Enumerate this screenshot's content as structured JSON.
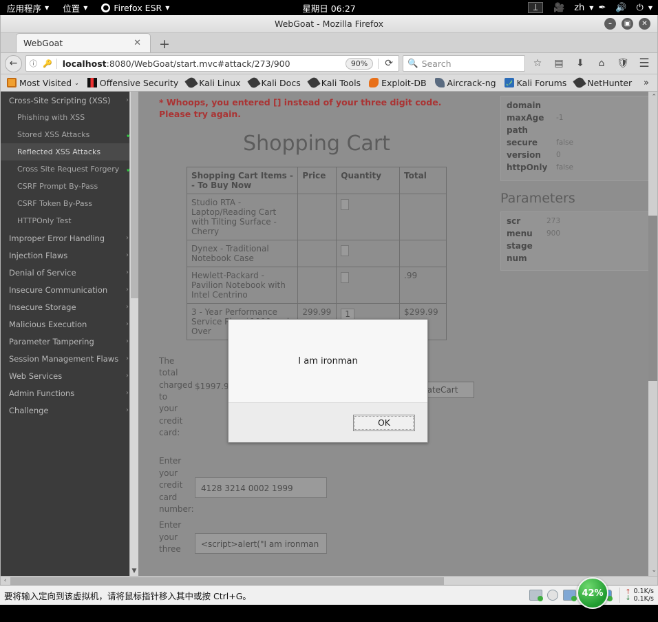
{
  "desktop": {
    "menus": [
      {
        "label": "应用程序",
        "icon": "apps-menu-icon"
      },
      {
        "label": "位置",
        "icon": "places-menu-icon"
      },
      {
        "label": "Firefox ESR",
        "icon": "firefox-icon"
      }
    ],
    "clock": "星期日 06:27",
    "workspace": "1",
    "tray": [
      {
        "name": "camera-icon",
        "glyph": "🎥"
      },
      {
        "name": "input-method-label",
        "glyph": "zh"
      },
      {
        "name": "pen-icon",
        "glyph": "✒"
      },
      {
        "name": "volume-icon",
        "glyph": "🔊"
      },
      {
        "name": "power-icon",
        "glyph": "⏻"
      }
    ]
  },
  "window": {
    "title": "WebGoat - Mozilla Firefox",
    "minimize": "–",
    "maximize": "▣",
    "close": "✕"
  },
  "tabs": {
    "items": [
      {
        "title": "WebGoat",
        "close": "✕"
      }
    ],
    "new_tab": "+"
  },
  "nav": {
    "back": "←",
    "info_icon": "ⓘ",
    "key_icon": "🔑",
    "url_host": "localhost",
    "url_rest": ":8080/WebGoat/start.mvc#attack/273/900",
    "zoom": "90%",
    "reload": "⟳",
    "search_placeholder": "Search",
    "search_icon": "🔍",
    "toolbar_icons": [
      {
        "name": "bookmark-star-icon",
        "glyph": "☆"
      },
      {
        "name": "library-icon",
        "glyph": "▤"
      },
      {
        "name": "downloads-icon",
        "glyph": "⬇"
      },
      {
        "name": "home-icon",
        "glyph": "⌂"
      },
      {
        "name": "shield-icon",
        "glyph": "🛡"
      },
      {
        "name": "hamburger-menu-icon",
        "glyph": "☰"
      }
    ]
  },
  "bookmarks": {
    "items": [
      {
        "label": "Most Visited",
        "icon": "ico-mv",
        "caret": "⌄"
      },
      {
        "label": "Offensive Security",
        "icon": "ico-os"
      },
      {
        "label": "Kali Linux",
        "icon": "ico-dragon"
      },
      {
        "label": "Kali Docs",
        "icon": "ico-dragon"
      },
      {
        "label": "Kali Tools",
        "icon": "ico-dragon"
      },
      {
        "label": "Exploit-DB",
        "icon": "ico-exp"
      },
      {
        "label": "Aircrack-ng",
        "icon": "ico-air"
      },
      {
        "label": "Kali Forums",
        "icon": "ico-kf"
      },
      {
        "label": "NetHunter",
        "icon": "ico-dragon"
      }
    ],
    "overflow": "»"
  },
  "sidebar": {
    "items": [
      {
        "label": "Cross-Site Scripting (XSS)",
        "type": "group",
        "chevron": "›"
      },
      {
        "label": "Phishing with XSS",
        "type": "sub"
      },
      {
        "label": "Stored XSS Attacks",
        "type": "sub",
        "check": "✅"
      },
      {
        "label": "Reflected XSS Attacks",
        "type": "sub",
        "active": true
      },
      {
        "label": "Cross Site Request Forgery (CSRF)",
        "type": "sub",
        "check": "✅"
      },
      {
        "label": "CSRF Prompt By-Pass",
        "type": "sub"
      },
      {
        "label": "CSRF Token By-Pass",
        "type": "sub"
      },
      {
        "label": "HTTPOnly Test",
        "type": "sub"
      },
      {
        "label": "Improper Error Handling",
        "type": "group",
        "chevron": "›"
      },
      {
        "label": "Injection Flaws",
        "type": "group",
        "chevron": "›"
      },
      {
        "label": "Denial of Service",
        "type": "group",
        "chevron": "›"
      },
      {
        "label": "Insecure Communication",
        "type": "group",
        "chevron": "›"
      },
      {
        "label": "Insecure Storage",
        "type": "group",
        "chevron": "›"
      },
      {
        "label": "Malicious Execution",
        "type": "group",
        "chevron": "›"
      },
      {
        "label": "Parameter Tampering",
        "type": "group",
        "chevron": "›"
      },
      {
        "label": "Session Management Flaws",
        "type": "group",
        "chevron": "›"
      },
      {
        "label": "Web Services",
        "type": "group",
        "chevron": "›"
      },
      {
        "label": "Admin Functions",
        "type": "group",
        "chevron": "›"
      },
      {
        "label": "Challenge",
        "type": "group",
        "chevron": "›"
      }
    ],
    "scroll_up": "▲",
    "scroll_down": "▼"
  },
  "main": {
    "error_message": "* Whoops, you entered [] instead of your three digit code. Please try again.",
    "title": "Shopping Cart",
    "table": {
      "headers": [
        "Shopping Cart Items -- To Buy Now",
        "Price",
        "Quantity",
        "Total"
      ],
      "rows": [
        {
          "item": "Studio RTA - Laptop/Reading Cart with Tilting Surface - Cherry",
          "price": "",
          "qty": "",
          "total": ""
        },
        {
          "item": "Dynex - Traditional Notebook Case",
          "price": "",
          "qty": "",
          "total": ""
        },
        {
          "item": "Hewlett-Packard - Pavilion Notebook with Intel Centrino",
          "price": "",
          "qty": "",
          "total": ".99"
        },
        {
          "item": "3 - Year Performance Service Plan $1000 and Over",
          "price": "299.99",
          "qty": "1",
          "total": "$299.99"
        }
      ]
    },
    "total_label": "The total charged to your credit card:",
    "total_value": "$1997.96",
    "update_cart": "UpdateCart",
    "cc_label": "Enter your credit card number:",
    "cc_value": "4128 3214 0002 1999",
    "code_label": "Enter your three",
    "code_value": "<script>alert(\"I am ironman"
  },
  "right_panel": {
    "cookie_fields": [
      {
        "key": "domain",
        "value": ""
      },
      {
        "key": "maxAge",
        "value": "-1"
      },
      {
        "key": "path",
        "value": ""
      },
      {
        "key": "secure",
        "value": "false"
      },
      {
        "key": "version",
        "value": "0"
      },
      {
        "key": "httpOnly",
        "value": "false"
      }
    ],
    "parameters_heading": "Parameters",
    "parameters": [
      {
        "key": "scr",
        "value": "273"
      },
      {
        "key": "menu",
        "value": "900"
      },
      {
        "key": "stage",
        "value": ""
      },
      {
        "key": "num",
        "value": ""
      }
    ],
    "scroll_up": "⌃",
    "scroll_down": "⌄"
  },
  "page_scroll": {
    "left": "‹",
    "right": "›"
  },
  "dialog": {
    "message": "I am ironman",
    "ok": "OK"
  },
  "vm_bar": {
    "message": "要将输入定向到该虚拟机，请将鼠标指针移入其中或按 Ctrl+G。",
    "cpu_percent": "42%",
    "upload_rate": "0.1K/s",
    "download_rate": "0.1K/s",
    "up_arrow": "↑",
    "down_arrow": "↓"
  }
}
